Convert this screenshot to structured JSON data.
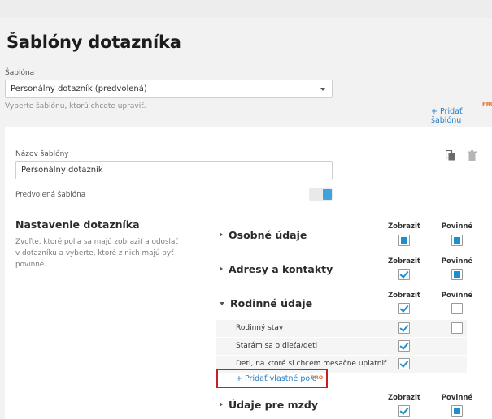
{
  "page_title": "Šablóny dotazníka",
  "template_select": {
    "label": "Šablóna",
    "value": "Personálny dotazník (predvolená)",
    "hint": "Vyberte šablónu, ktorú chcete upraviť."
  },
  "add_template": {
    "label": "+ Pridať šablónu",
    "badge": "PRO"
  },
  "card": {
    "name_label": "Názov šablóny",
    "name_value": "Personálny dotazník",
    "default_label": "Predvolená šablóna",
    "default_on": true
  },
  "settings": {
    "title": "Nastavenie dotazníka",
    "description": "Zvoľte, ktoré polia sa majú zobraziť a odoslať v dotazníku a vyberte, ktoré z nich majú byť povinné."
  },
  "columns": {
    "show": "Zobraziť",
    "required": "Povinné"
  },
  "groups": [
    {
      "label": "Osobné údaje",
      "expanded": false,
      "show": "filled",
      "required": "filled"
    },
    {
      "label": "Adresy a kontakty",
      "expanded": false,
      "show": "checked",
      "required": "filled"
    },
    {
      "label": "Rodinné údaje",
      "expanded": true,
      "show": "checked",
      "required": "empty"
    },
    {
      "label": "Údaje pre mzdy",
      "expanded": false,
      "show": "checked",
      "required": "filled"
    }
  ],
  "family_fields": [
    {
      "label": "Rodinný stav",
      "show": "checked",
      "required": "empty"
    },
    {
      "label": "Starám sa o dieťa/deti",
      "show": "checked",
      "required": null
    },
    {
      "label": "Deti, na ktoré si chcem mesačne uplatniť",
      "show": "checked",
      "required": null
    }
  ],
  "add_custom_field": {
    "label": "+ Pridať vlastné pole",
    "badge": "PRO"
  },
  "icons": {
    "copy": "copy-icon",
    "delete": "trash-icon"
  },
  "colors": {
    "accent": "#1d8fd1",
    "link": "#2a7dc2",
    "pro": "#e0712b",
    "highlight": "#c42026"
  }
}
